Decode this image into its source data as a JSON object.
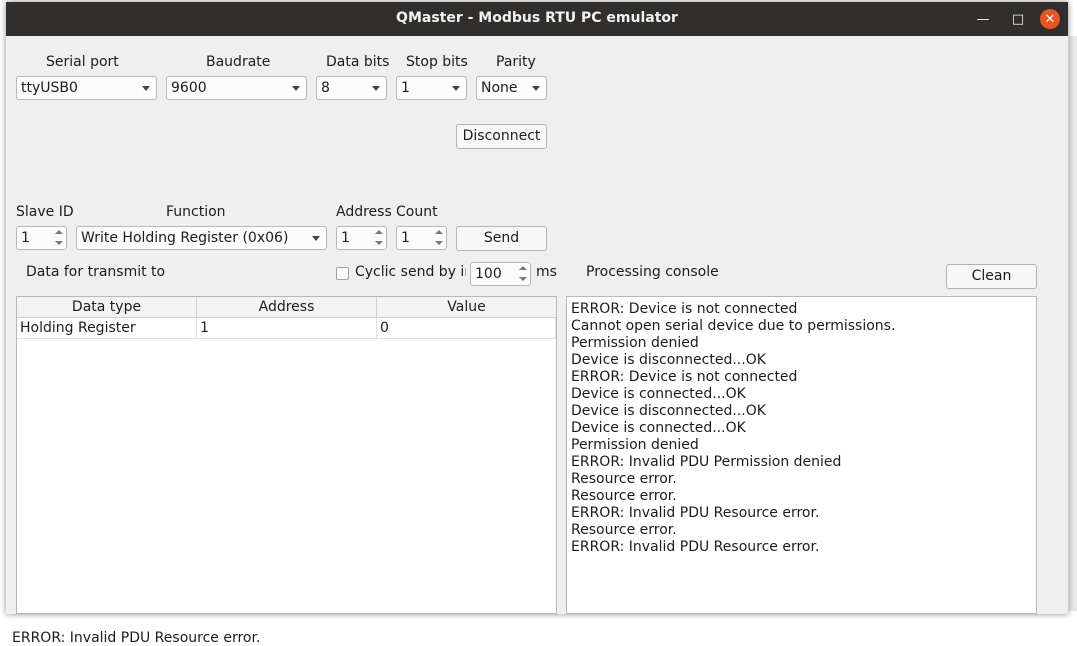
{
  "window": {
    "title": "QMaster - Modbus RTU PC emulator",
    "close_color": "#e95420"
  },
  "serial": {
    "port_label": "Serial port",
    "port_value": "ttyUSB0",
    "baud_label": "Baudrate",
    "baud_value": "9600",
    "databits_label": "Data bits",
    "databits_value": "8",
    "stopbits_label": "Stop bits",
    "stopbits_value": "1",
    "parity_label": "Parity",
    "parity_value": "None",
    "disconnect_label": "Disconnect"
  },
  "request": {
    "slave_label": "Slave ID",
    "slave_value": "1",
    "function_label": "Function",
    "function_value": "Write Holding Register (0x06)",
    "address_label": "Address",
    "address_value": "1",
    "count_label": "Count",
    "count_value": "1",
    "send_label": "Send"
  },
  "transmit": {
    "label": "Data for transmit to s",
    "cyclic_label": "Cyclic send by int",
    "cyclic_value": "100",
    "ms_label": "ms"
  },
  "table": {
    "headers": [
      "Data type",
      "Address",
      "Value"
    ],
    "rows": [
      [
        "Holding Register",
        "1",
        "0"
      ]
    ]
  },
  "console": {
    "title": "Processing console",
    "clean_label": "Clean",
    "lines": [
      "ERROR: Device is not connected",
      "Cannot open serial device due to permissions.",
      "Permission denied",
      "Device is disconnected...OK",
      "ERROR: Device is not connected",
      "Device is connected...OK",
      "Device is disconnected...OK",
      "Device is connected...OK",
      "Permission denied",
      "ERROR: Invalid PDU Permission denied",
      "Resource error.",
      "Resource error.",
      "ERROR: Invalid PDU Resource error.",
      "Resource error.",
      "ERROR: Invalid PDU Resource error."
    ]
  },
  "status": {
    "text": "ERROR: Invalid PDU Resource error."
  }
}
